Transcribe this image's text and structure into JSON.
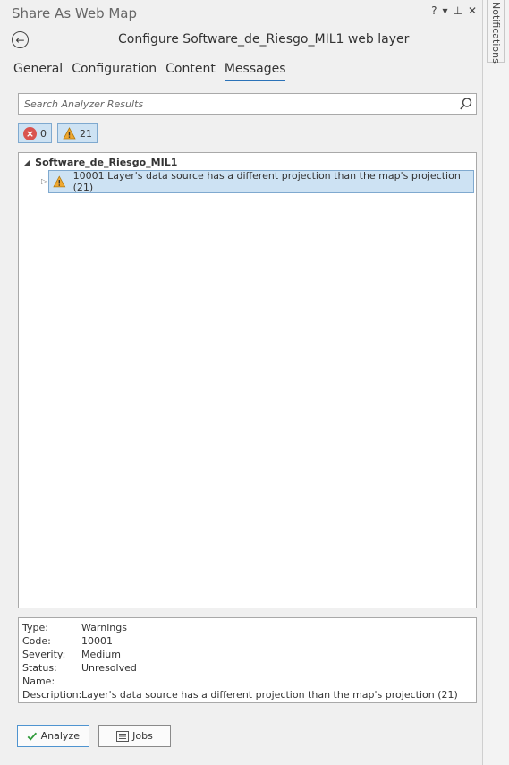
{
  "window": {
    "title": "Share As Web Map",
    "controls": [
      "?",
      "▾",
      "⊥",
      "✕"
    ]
  },
  "header": {
    "title": "Configure Software_de_Riesgo_MIL1 web layer"
  },
  "tabs": [
    {
      "label": "General",
      "active": false
    },
    {
      "label": "Configuration",
      "active": false
    },
    {
      "label": "Content",
      "active": false
    },
    {
      "label": "Messages",
      "active": true
    }
  ],
  "search": {
    "placeholder": "Search Analyzer Results",
    "value": ""
  },
  "filters": {
    "errors_count": "0",
    "warnings_count": "21"
  },
  "tree": {
    "root_label": "Software_de_Riesgo_MIL1",
    "items": [
      {
        "label": "10001 Layer's data source has a different projection than the map's projection (21)"
      }
    ]
  },
  "details": {
    "rows": [
      {
        "label": "Type:",
        "value": "Warnings"
      },
      {
        "label": "Code:",
        "value": "10001"
      },
      {
        "label": "Severity:",
        "value": "Medium"
      },
      {
        "label": "Status:",
        "value": "Unresolved"
      },
      {
        "label": "Name:",
        "value": ""
      },
      {
        "label": "Description:",
        "value": "Layer's data source has a different projection than the map's projection (21)"
      }
    ]
  },
  "buttons": {
    "analyze": "Analyze",
    "jobs": "Jobs"
  },
  "side_panel": {
    "tab_label": "Notifications"
  },
  "colors": {
    "accent": "#2a72b8",
    "selection": "#cde2f3",
    "error": "#d9534f",
    "warning": "#f0a830"
  }
}
